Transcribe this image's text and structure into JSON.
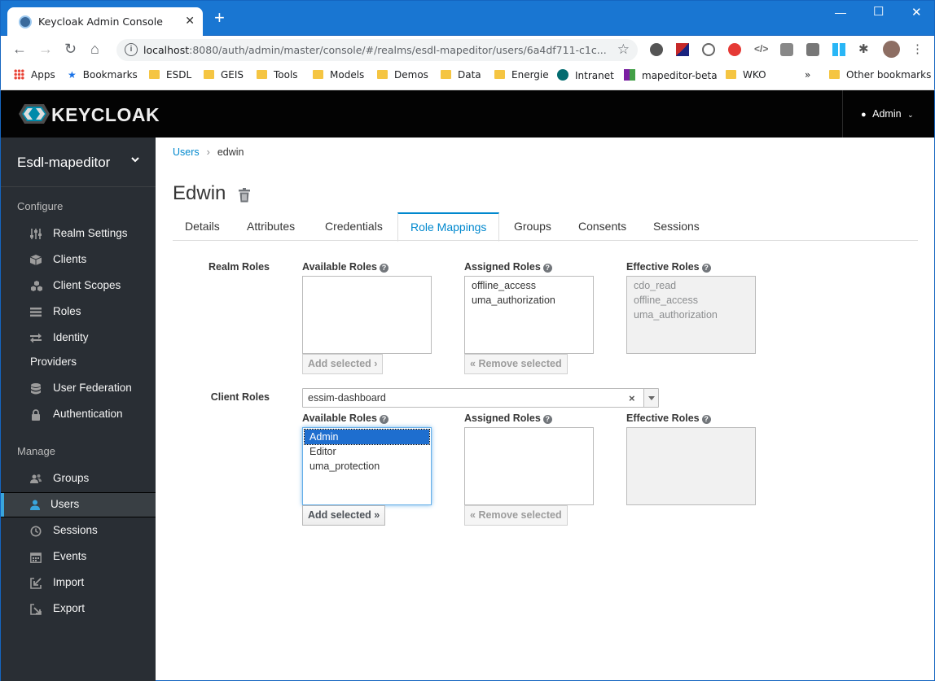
{
  "browser": {
    "tab_title": "Keycloak Admin Console",
    "url_host": "localhost",
    "url_rest": ":8080/auth/admin/master/console/#/realms/esdl-mapeditor/users/6a4df711-c1c...",
    "bookmarks": [
      "Apps",
      "Bookmarks",
      "ESDL",
      "GEIS",
      "Tools",
      "Models",
      "Demos",
      "Data",
      "Energie",
      "Intranet",
      "mapeditor-beta",
      "WKO"
    ],
    "other_bookmarks": "Other bookmarks",
    "overflow": "»"
  },
  "header": {
    "logo_text": "KEYCLOAK",
    "user": "Admin"
  },
  "sidebar": {
    "realm": "Esdl-mapeditor",
    "configure_label": "Configure",
    "manage_label": "Manage",
    "configure_items": [
      {
        "label": "Realm Settings",
        "icon": "sliders-icon"
      },
      {
        "label": "Clients",
        "icon": "cube-icon"
      },
      {
        "label": "Client Scopes",
        "icon": "cubes-icon"
      },
      {
        "label": "Roles",
        "icon": "list-icon"
      },
      {
        "label": "Identity",
        "icon": "exchange-icon"
      },
      {
        "label": "Providers",
        "icon": ""
      },
      {
        "label": "User Federation",
        "icon": "database-icon"
      },
      {
        "label": "Authentication",
        "icon": "lock-icon"
      }
    ],
    "manage_items": [
      {
        "label": "Groups",
        "icon": "users-icon"
      },
      {
        "label": "Users",
        "icon": "user-icon"
      },
      {
        "label": "Sessions",
        "icon": "clock-icon"
      },
      {
        "label": "Events",
        "icon": "calendar-icon"
      },
      {
        "label": "Import",
        "icon": "import-icon"
      },
      {
        "label": "Export",
        "icon": "export-icon"
      }
    ]
  },
  "breadcrumb": {
    "parent": "Users",
    "current": "edwin"
  },
  "page_title": "Edwin",
  "tabs": [
    "Details",
    "Attributes",
    "Credentials",
    "Role Mappings",
    "Groups",
    "Consents",
    "Sessions"
  ],
  "active_tab": "Role Mappings",
  "role_mappings": {
    "realm_roles_label": "Realm Roles",
    "client_roles_label": "Client Roles",
    "available_label": "Available Roles",
    "assigned_label": "Assigned Roles",
    "effective_label": "Effective Roles",
    "realm": {
      "available": [],
      "assigned": [
        "offline_access",
        "uma_authorization"
      ],
      "effective": [
        "cdo_read",
        "offline_access",
        "uma_authorization"
      ]
    },
    "client_select": "essim-dashboard",
    "client": {
      "available": [
        "Admin",
        "Editor",
        "uma_protection"
      ],
      "selected": "Admin",
      "assigned": [],
      "effective": []
    },
    "add_selected": "Add selected",
    "remove_selected": "Remove selected"
  }
}
